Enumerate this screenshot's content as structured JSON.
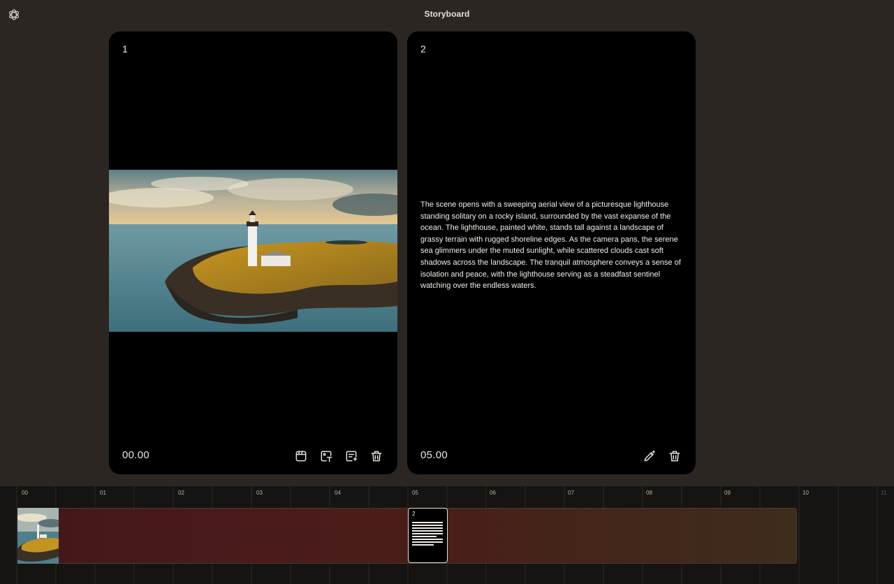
{
  "app": {
    "title": "Storyboard",
    "logo_icon": "openai-logo-icon"
  },
  "cards": [
    {
      "number": "1",
      "time": "00.00",
      "media": "image",
      "actions": [
        {
          "name": "storyboard-card-icon"
        },
        {
          "name": "image-text-icon"
        },
        {
          "name": "caption-icon"
        },
        {
          "name": "trash-icon"
        }
      ]
    },
    {
      "number": "2",
      "time": "05.00",
      "media": "text",
      "description": "The scene opens with a sweeping aerial view of a picturesque lighthouse standing solitary on a rocky island, surrounded by the vast expanse of the ocean. The lighthouse, painted white, stands tall against a landscape of grassy terrain with rugged shoreline edges. As the camera pans, the serene sea glimmers under the muted sunlight, while scattered clouds cast soft shadows across the landscape. The tranquil atmosphere conveys a sense of isolation and peace, with the lighthouse serving as a steadfast sentinel watching over the endless waters.",
      "actions": [
        {
          "name": "edit-pen-icon"
        },
        {
          "name": "trash-icon"
        }
      ]
    }
  ],
  "timeline": {
    "ticks": [
      "00",
      "01",
      "02",
      "03",
      "04",
      "05",
      "06",
      "07",
      "08",
      "09",
      "10",
      "11"
    ],
    "clips": [
      {
        "type": "image"
      },
      {
        "type": "text",
        "number": "2"
      }
    ]
  },
  "colors": {
    "background": "#2b2622",
    "card": "#000000",
    "timeline": "#161412",
    "track_start": "#43181a",
    "track_end": "#3e2c1d"
  }
}
